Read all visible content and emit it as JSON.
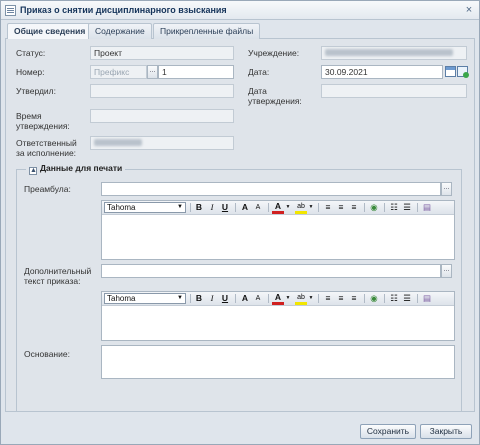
{
  "window": {
    "title": "Приказ о снятии дисциплинарного взыскания",
    "close_glyph": "×"
  },
  "tabs": [
    {
      "label": "Общие сведения",
      "active": true
    },
    {
      "label": "Содержание",
      "active": false
    },
    {
      "label": "Прикрепленные файлы",
      "active": false
    }
  ],
  "form": {
    "status_label": "Статус:",
    "status_value": "Проект",
    "number_label": "Номер:",
    "number_prefix_placeholder": "Префикс",
    "number_picker": "...",
    "number_value": "1",
    "approved_label": "Утвердил:",
    "approval_time_label_1": "Время",
    "approval_time_label_2": "утверждения:",
    "responsible_label_1": "Ответственный",
    "responsible_label_2": "за исполнение:",
    "institution_label": "Учреждение:",
    "date_label": "Дата:",
    "date_value": "30.09.2021",
    "approval_date_label_1": "Дата",
    "approval_date_label_2": "утверждения:"
  },
  "print_section": {
    "title": "Данные для печати",
    "toggle": "▲",
    "preamble_label": "Преамбула:",
    "extra_label_1": "Дополнительный",
    "extra_label_2": "текст приказа:",
    "basis_label": "Основание:",
    "picker": "..."
  },
  "editor": {
    "font": "Tahoma",
    "bold": "B",
    "italic": "I",
    "underline": "U",
    "grow": "A",
    "shrink": "A",
    "font_color": "A",
    "highlight": "ab",
    "colors": {
      "font_color": "#d02020",
      "highlight": "#f2e600"
    }
  },
  "footer": {
    "save_label": "Сохранить",
    "close_label": "Закрыть"
  }
}
